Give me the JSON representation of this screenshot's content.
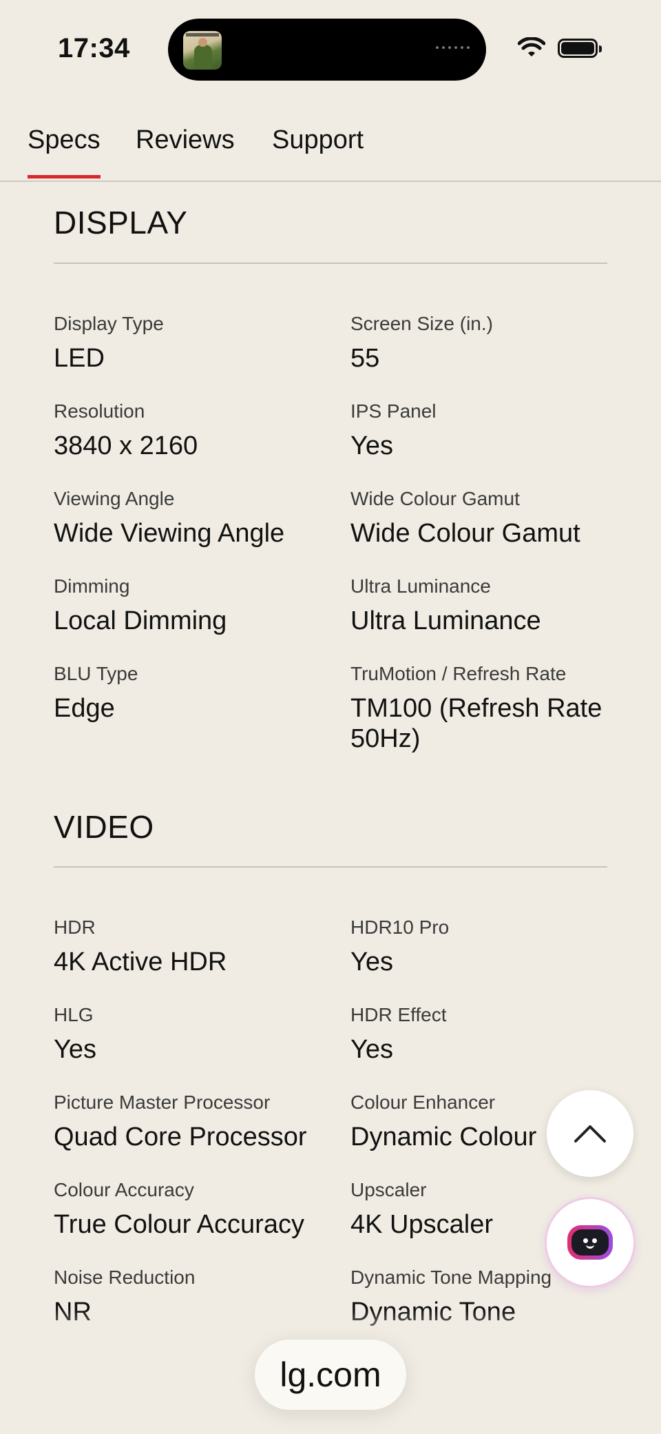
{
  "status_bar": {
    "time": "17:34"
  },
  "tabs": [
    {
      "label": "Specs",
      "active": true
    },
    {
      "label": "Reviews",
      "active": false
    },
    {
      "label": "Support",
      "active": false
    }
  ],
  "sections": [
    {
      "title": "DISPLAY",
      "specs": [
        {
          "label": "Display Type",
          "value": "LED"
        },
        {
          "label": "Screen Size (in.)",
          "value": "55"
        },
        {
          "label": "Resolution",
          "value": "3840 x 2160"
        },
        {
          "label": "IPS Panel",
          "value": "Yes"
        },
        {
          "label": "Viewing Angle",
          "value": "Wide Viewing Angle"
        },
        {
          "label": "Wide Colour Gamut",
          "value": "Wide Colour Gamut"
        },
        {
          "label": "Dimming",
          "value": "Local Dimming"
        },
        {
          "label": "Ultra Luminance",
          "value": "Ultra Luminance"
        },
        {
          "label": "BLU Type",
          "value": "Edge"
        },
        {
          "label": "TruMotion / Refresh Rate",
          "value": "TM100 (Refresh Rate 50Hz)"
        }
      ]
    },
    {
      "title": "VIDEO",
      "specs": [
        {
          "label": "HDR",
          "value": "4K Active HDR"
        },
        {
          "label": "HDR10 Pro",
          "value": "Yes"
        },
        {
          "label": "HLG",
          "value": "Yes"
        },
        {
          "label": "HDR Effect",
          "value": "Yes"
        },
        {
          "label": "Picture Master Processor",
          "value": "Quad Core Processor"
        },
        {
          "label": "Colour Enhancer",
          "value": "Dynamic Colour"
        },
        {
          "label": "Colour Accuracy",
          "value": "True Colour Accuracy"
        },
        {
          "label": "Upscaler",
          "value": "4K Upscaler"
        },
        {
          "label": "Noise Reduction",
          "value": "NR"
        },
        {
          "label": "Dynamic Tone Mapping",
          "value": "Dynamic Tone"
        }
      ]
    }
  ],
  "url_bar": {
    "domain": "lg.com"
  },
  "colors": {
    "accent": "#d9262a",
    "background": "#f0ece3"
  }
}
